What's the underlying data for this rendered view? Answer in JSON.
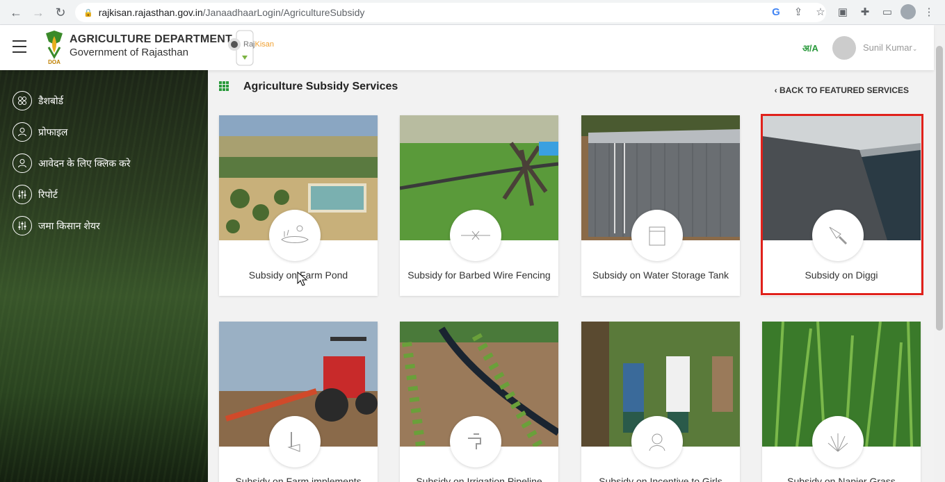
{
  "browser": {
    "url_host": "rajkisan.rajasthan.gov.in",
    "url_path": "/JanaadhaarLogin/AgricultureSubsidy"
  },
  "header": {
    "dept_title": "AGRICULTURE DEPARTMENT",
    "dept_subtitle": "Government of Rajasthan",
    "logo_small_text": "DOA",
    "brand_prefix": "Raj",
    "brand_suffix": "Kisan",
    "lang_toggle": "अ/A",
    "user_name": "Sunil Kumar"
  },
  "sidebar": {
    "items": [
      {
        "label": "डैशबोर्ड",
        "icon": "dashboard-icon"
      },
      {
        "label": "प्रोफाइल",
        "icon": "user-icon"
      },
      {
        "label": "आवेदन के लिए क्लिक करे",
        "icon": "user-icon"
      },
      {
        "label": "रिपोर्ट",
        "icon": "sliders-icon"
      },
      {
        "label": "जमा किसान शेयर",
        "icon": "sliders-icon"
      }
    ]
  },
  "main": {
    "title": "Agriculture Subsidy Services",
    "back_link": "‹ BACK TO FEATURED SERVICES",
    "cards": [
      {
        "label": "Subsidy on Farm Pond"
      },
      {
        "label": "Subsidy for Barbed Wire Fencing"
      },
      {
        "label": "Subsidy on Water Storage Tank"
      },
      {
        "label": "Subsidy on Diggi"
      },
      {
        "label": "Subsidy on Farm implements"
      },
      {
        "label": "Subsidy on Irrigation Pipeline"
      },
      {
        "label": "Subsidy on Incentive to Girls"
      },
      {
        "label": "Subsidy on Napier Grass"
      }
    ]
  },
  "colors": {
    "accent_green": "#2a9a3c",
    "highlight_red": "#e0211b"
  }
}
